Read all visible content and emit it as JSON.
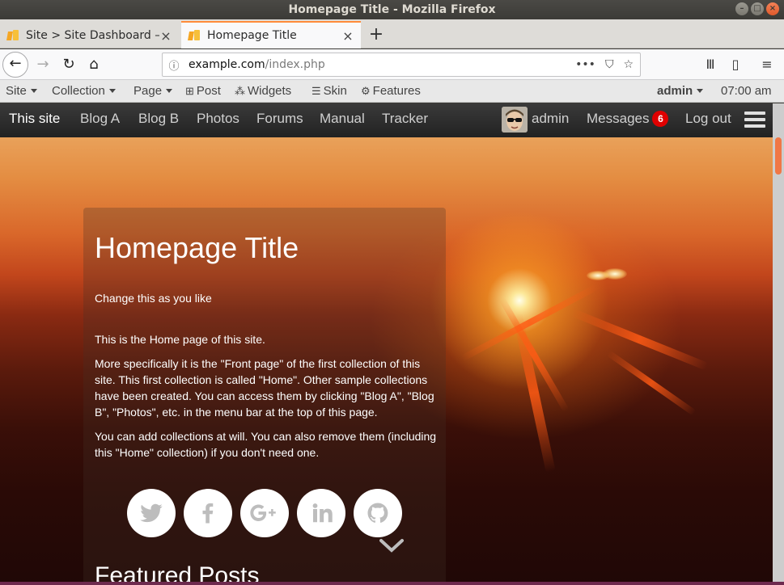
{
  "window": {
    "title": "Homepage Title - Mozilla Firefox",
    "controls": [
      "minimize",
      "maximize",
      "close"
    ]
  },
  "tabs": [
    {
      "label": "Site > Site Dashboard – b",
      "active": false
    },
    {
      "label": "Homepage Title",
      "active": true
    }
  ],
  "urlbar": {
    "host": "example.com",
    "path": "/index.php"
  },
  "admin_toolbar": {
    "items": [
      "Site",
      "Collection",
      "Page",
      "Post",
      "Widgets",
      "Skin",
      "Features"
    ],
    "user": "admin",
    "time": "07:00 am"
  },
  "site_menu": {
    "items": [
      "This site",
      "Blog A",
      "Blog B",
      "Photos",
      "Forums",
      "Manual",
      "Tracker"
    ],
    "active": "This site",
    "user": "admin",
    "messages_label": "Messages",
    "messages_count": "6",
    "logout": "Log out"
  },
  "hero": {
    "title": "Homepage Title",
    "subtitle": "Change this as you like",
    "paragraphs": [
      "This is the Home page of this site.",
      "More specifically it is the \"Front page\" of the first collection of this site. This first collection is called \"Home\". Other sample collections have been created. You can access them by clicking \"Blog A\", \"Blog B\", \"Photos\", etc. in the menu bar at the top of this page.",
      "You can add collections at will. You can also remove them (including this \"Home\" collection) if you don't need one."
    ],
    "social": [
      "twitter-icon",
      "facebook-icon",
      "google-plus-icon",
      "linkedin-icon",
      "github-icon"
    ],
    "featured_heading": "Featured Posts"
  },
  "colors": {
    "tab_accent": "#ff8c3a",
    "badge": "#e00000",
    "menu_bg": "#2a2a2a"
  }
}
